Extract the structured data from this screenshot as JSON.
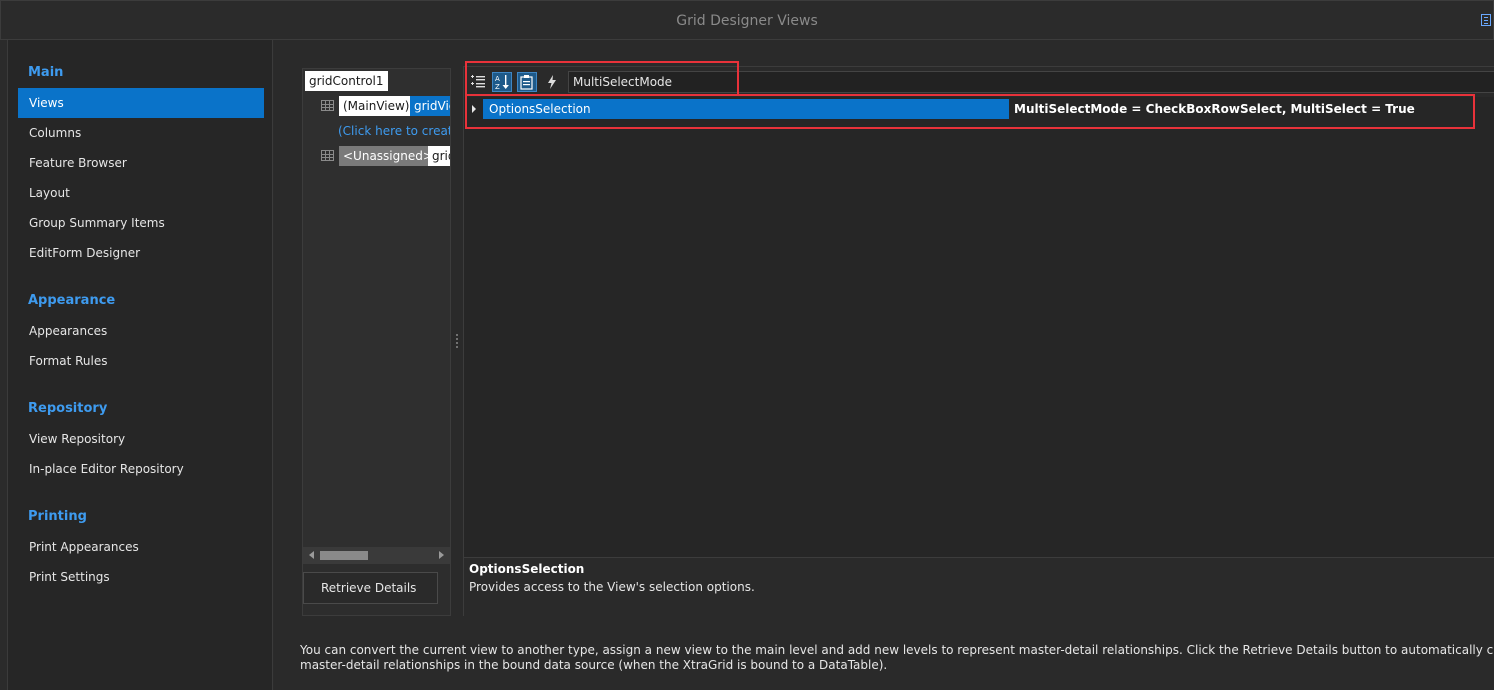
{
  "window": {
    "title": "Grid Designer Views"
  },
  "sidebar": {
    "sections": [
      {
        "label": "Main",
        "items": [
          "Views",
          "Columns",
          "Feature Browser",
          "Layout",
          "Group Summary Items",
          "EditForm Designer"
        ]
      },
      {
        "label": "Appearance",
        "items": [
          "Appearances",
          "Format Rules"
        ]
      },
      {
        "label": "Repository",
        "items": [
          "View Repository",
          "In-place Editor Repository"
        ]
      },
      {
        "label": "Printing",
        "items": [
          "Print Appearances",
          "Print Settings"
        ]
      }
    ],
    "active_item": "Views"
  },
  "tree": {
    "root": "gridControl1",
    "main_view_label": "(MainView)",
    "main_view_name": "gridVie",
    "create_link": "(Click here to create",
    "unassigned_label": "<Unassigned>",
    "unassigned_name": "grid"
  },
  "buttons": {
    "retrieve_details": "Retrieve Details"
  },
  "properties": {
    "search_value": "MultiSelectMode",
    "row": {
      "name": "OptionsSelection",
      "value": "MultiSelectMode = CheckBoxRowSelect, MultiSelect = True"
    },
    "description": {
      "title": "OptionsSelection",
      "text": "Provides access to the View's selection options."
    }
  },
  "footer": {
    "line1": "You can convert the current view to another type, assign a new view to the main level and add new levels to represent master-detail relationships. Click the Retrieve Details button to automatically create levels for all t",
    "line2": "master-detail relationships in the bound data source (when the XtraGrid is bound to a DataTable)."
  },
  "colors": {
    "accent": "#0a73c9",
    "section": "#3e9bef",
    "highlight": "#e8323a"
  }
}
